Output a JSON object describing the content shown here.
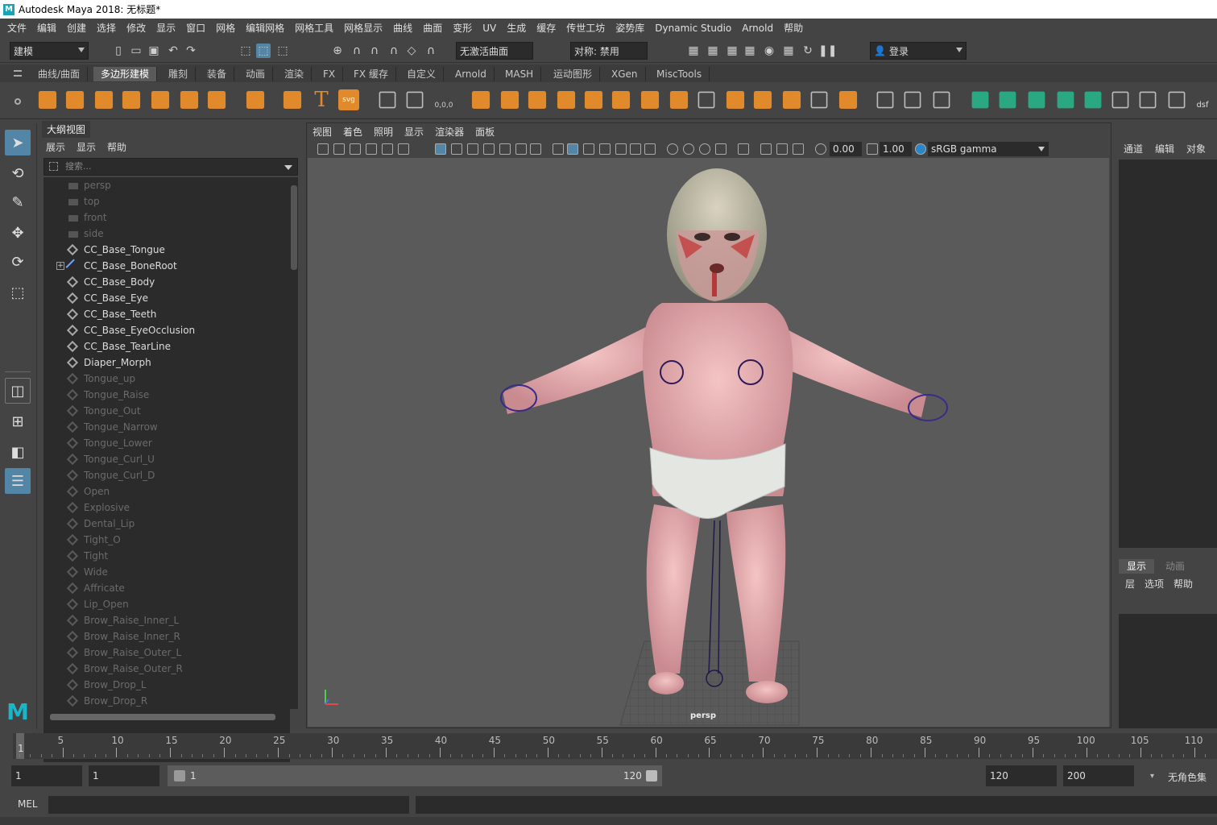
{
  "window": {
    "title": "Autodesk Maya 2018: 无标题*",
    "logo": "M"
  },
  "menubar": [
    "文件",
    "编辑",
    "创建",
    "选择",
    "修改",
    "显示",
    "窗口",
    "网格",
    "编辑网格",
    "网格工具",
    "网格显示",
    "曲线",
    "曲面",
    "变形",
    "UV",
    "生成",
    "缓存",
    "传世工坊",
    "姿势库",
    "Dynamic Studio",
    "Arnold",
    "帮助"
  ],
  "statusline": {
    "mode": "建模",
    "live_surface": "无激活曲面",
    "symmetry": "对称: 禁用",
    "login": "登录"
  },
  "shelf": {
    "tabs": [
      "曲线/曲面",
      "多边形建模",
      "雕刻",
      "装备",
      "动画",
      "渲染",
      "FX",
      "FX 缓存",
      "自定义",
      "Arnold",
      "MASH",
      "运动图形",
      "XGen",
      "MiscTools"
    ],
    "active_tab": "多边形建模",
    "icon_labels": {
      "text_tool": "T",
      "svg_tool": "svg",
      "dsf": "dsf",
      "coord": "0,0,0"
    }
  },
  "outliner": {
    "title": "大纲视图",
    "menu": [
      "展示",
      "显示",
      "帮助"
    ],
    "search_placeholder": "搜索...",
    "items": [
      {
        "label": "persp",
        "type": "camera",
        "dim": true
      },
      {
        "label": "top",
        "type": "camera",
        "dim": true
      },
      {
        "label": "front",
        "type": "camera",
        "dim": true
      },
      {
        "label": "side",
        "type": "camera",
        "dim": true
      },
      {
        "label": "CC_Base_Tongue",
        "type": "mesh",
        "dim": false
      },
      {
        "label": "CC_Base_BoneRoot",
        "type": "joint",
        "dim": false,
        "expandable": true
      },
      {
        "label": "CC_Base_Body",
        "type": "mesh",
        "dim": false
      },
      {
        "label": "CC_Base_Eye",
        "type": "mesh",
        "dim": false
      },
      {
        "label": "CC_Base_Teeth",
        "type": "mesh",
        "dim": false
      },
      {
        "label": "CC_Base_EyeOcclusion",
        "type": "mesh",
        "dim": false
      },
      {
        "label": "CC_Base_TearLine",
        "type": "mesh",
        "dim": false
      },
      {
        "label": "Diaper_Morph",
        "type": "mesh",
        "dim": false
      },
      {
        "label": "Tongue_up",
        "type": "mesh",
        "dim": true
      },
      {
        "label": "Tongue_Raise",
        "type": "mesh",
        "dim": true
      },
      {
        "label": "Tongue_Out",
        "type": "mesh",
        "dim": true
      },
      {
        "label": "Tongue_Narrow",
        "type": "mesh",
        "dim": true
      },
      {
        "label": "Tongue_Lower",
        "type": "mesh",
        "dim": true
      },
      {
        "label": "Tongue_Curl_U",
        "type": "mesh",
        "dim": true
      },
      {
        "label": "Tongue_Curl_D",
        "type": "mesh",
        "dim": true
      },
      {
        "label": "Open",
        "type": "mesh",
        "dim": true
      },
      {
        "label": "Explosive",
        "type": "mesh",
        "dim": true
      },
      {
        "label": "Dental_Lip",
        "type": "mesh",
        "dim": true
      },
      {
        "label": "Tight_O",
        "type": "mesh",
        "dim": true
      },
      {
        "label": "Tight",
        "type": "mesh",
        "dim": true
      },
      {
        "label": "Wide",
        "type": "mesh",
        "dim": true
      },
      {
        "label": "Affricate",
        "type": "mesh",
        "dim": true
      },
      {
        "label": "Lip_Open",
        "type": "mesh",
        "dim": true
      },
      {
        "label": "Brow_Raise_Inner_L",
        "type": "mesh",
        "dim": true
      },
      {
        "label": "Brow_Raise_Inner_R",
        "type": "mesh",
        "dim": true
      },
      {
        "label": "Brow_Raise_Outer_L",
        "type": "mesh",
        "dim": true
      },
      {
        "label": "Brow_Raise_Outer_R",
        "type": "mesh",
        "dim": true
      },
      {
        "label": "Brow_Drop_L",
        "type": "mesh",
        "dim": true
      },
      {
        "label": "Brow_Drop_R",
        "type": "mesh",
        "dim": true
      }
    ]
  },
  "viewport": {
    "menu": [
      "视图",
      "着色",
      "照明",
      "显示",
      "渲染器",
      "面板"
    ],
    "exposure": "0.00",
    "gamma": "1.00",
    "colorspace": "sRGB gamma",
    "camera_label": "persp"
  },
  "channelbox": {
    "tabs": [
      "通道",
      "编辑",
      "对象"
    ],
    "layer_tabs": [
      "显示",
      "动画"
    ],
    "layer_menu": [
      "层",
      "选项",
      "帮助"
    ]
  },
  "timeline": {
    "ticks": [
      5,
      10,
      15,
      20,
      25,
      30,
      35,
      40,
      45,
      50,
      55,
      60,
      65,
      70,
      75,
      80,
      85,
      90,
      95,
      100,
      105,
      110
    ],
    "current_frame": "1"
  },
  "range": {
    "start": "1",
    "playback_start": "1",
    "slider_start": "1",
    "slider_end": "120",
    "playback_end": "120",
    "end": "200",
    "character_set": "无角色集"
  },
  "commandline": {
    "label": "MEL"
  },
  "colors": {
    "accent": "#5285a6",
    "shelf_orange": "#e08a2c",
    "shelf_green": "#2aa882"
  }
}
